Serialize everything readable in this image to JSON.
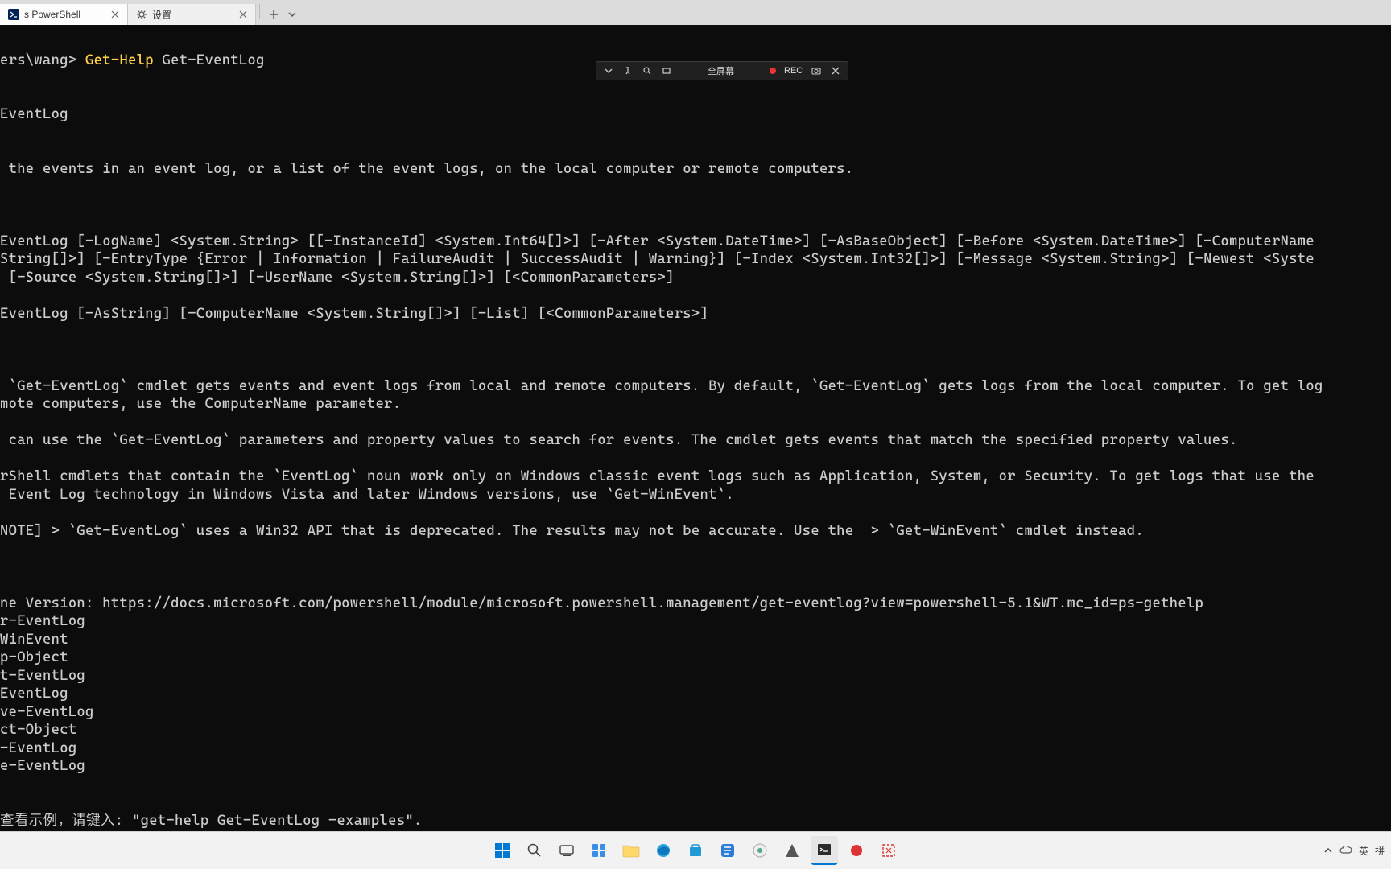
{
  "tabs": [
    {
      "label": "s PowerShell",
      "icon": "ps"
    },
    {
      "label": "设置",
      "icon": "gear"
    }
  ],
  "terminal": {
    "prompt": "ers\\wang> ",
    "cmd1": "Get-Help",
    "cmd2": " Get-EventLog",
    "name": "EventLog",
    "synopsis": " the events in an event log, or a list of the event logs, on the local computer or remote computers.",
    "syntax1": "EventLog [-LogName] <System.String> [[-InstanceId] <System.Int64[]>] [-After <System.DateTime>] [-AsBaseObject] [-Before <System.DateTime>] [-ComputerName",
    "syntax2": "String[]>] [-EntryType {Error | Information | FailureAudit | SuccessAudit | Warning}] [-Index <System.Int32[]>] [-Message <System.String>] [-Newest <Syste",
    "syntax3": " [-Source <System.String[]>] [-UserName <System.String[]>] [<CommonParameters>]",
    "syntax4": "EventLog [-AsString] [-ComputerName <System.String[]>] [-List] [<CommonParameters>]",
    "desc1": " `Get-EventLog` cmdlet gets events and event logs from local and remote computers. By default, `Get-EventLog` gets logs from the local computer. To get log",
    "desc2": "mote computers, use the ComputerName parameter.",
    "desc3": " can use the `Get-EventLog` parameters and property values to search for events. The cmdlet gets events that match the specified property values.",
    "desc4": "rShell cmdlets that contain the `EventLog` noun work only on Windows classic event logs such as Application, System, or Security. To get logs that use the",
    "desc5": " Event Log technology in Windows Vista and later Windows versions, use `Get-WinEvent`.",
    "desc6": "NOTE] > `Get-EventLog` uses a Win32 API that is deprecated. The results may not be accurate. Use the  > `Get-WinEvent` cmdlet instead.",
    "link": "ne Version: https://docs.microsoft.com/powershell/module/microsoft.powershell.management/get-eventlog?view=powershell-5.1&WT.mc_id=ps-gethelp",
    "rel1": "r-EventLog",
    "rel2": "WinEvent",
    "rel3": "p-Object",
    "rel4": "t-EventLog",
    "rel5": "EventLog",
    "rel6": "ve-EventLog",
    "rel7": "ct-Object",
    "rel8": "-EventLog",
    "rel9": "e-EventLog",
    "remark": "查看示例，请键入: \"get-help Get-EventLog -examples\"."
  },
  "recbar": {
    "mode": "全屏幕",
    "rec": "REC"
  },
  "systray": {
    "ime1": "英",
    "ime2": "拼"
  }
}
